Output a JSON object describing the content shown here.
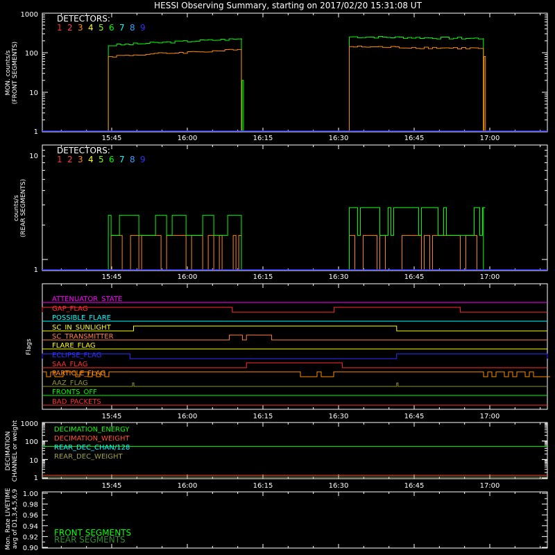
{
  "title": "HESSI Observing Summary, starting on 2017/02/20 15:31:08 UT",
  "time_ticks": [
    "15:45",
    "16:00",
    "16:15",
    "16:30",
    "16:45",
    "17:00"
  ],
  "detectors": {
    "heading": "DETECTORS:",
    "numbers": [
      "1",
      "2",
      "3",
      "4",
      "5",
      "6",
      "7",
      "8",
      "9"
    ],
    "colors": [
      "#ff3030",
      "#ff4040",
      "#ff8c00",
      "#ffff00",
      "#88ff00",
      "#00ff00",
      "#00ffff",
      "#3aa0ff",
      "#3030ff"
    ]
  },
  "panels": {
    "front": {
      "ylabel": [
        "MON. counts/s",
        "(FRONT SEGMENTS)"
      ],
      "yticks": [
        "1000",
        "100",
        "10",
        "1"
      ]
    },
    "rear": {
      "ylabel": [
        "counts/s",
        "(REAR SEGMENTS)"
      ],
      "yticks": [
        "10",
        "1"
      ]
    },
    "flags": {
      "ylabel": "Flags",
      "items": [
        {
          "label": "ATTENUATOR_STATE",
          "color": "#ff00ff"
        },
        {
          "label": "GAP_FLAG",
          "color": "#ff3030"
        },
        {
          "label": "POSSIBLE_FLARE",
          "color": "#00ffff"
        },
        {
          "label": "SC_IN_SUNLIGHT",
          "color": "#ffff00"
        },
        {
          "label": "SC_TRANSMITTER",
          "color": "#ff8040"
        },
        {
          "label": "FLARE_FLAG",
          "color": "#ffff00"
        },
        {
          "label": "ECLIPSE_FLAG",
          "color": "#3030ff"
        },
        {
          "label": "SAA_FLAG",
          "color": "#ff3030"
        },
        {
          "label": "PARTICLE_FLAG",
          "color": "#ff8c00"
        },
        {
          "label": "AAZ_FLAG",
          "color": "#909030"
        },
        {
          "label": "FRONTS_OFF",
          "color": "#00ff00"
        },
        {
          "label": "BAD_PACKETS",
          "color": "#ff3030"
        }
      ]
    },
    "decimation": {
      "ylabel": [
        "DECIMATION",
        "CHANNEL or weight"
      ],
      "yticks": [
        "1000",
        "100",
        "10",
        "1"
      ],
      "legend": [
        {
          "label": "DECIMATION_ENERGY",
          "color": "#00ff00"
        },
        {
          "label": "DECIMATION_WEIGHT",
          "color": "#ff5030"
        },
        {
          "label": "REAR_DEC_CHAN/128",
          "color": "#00ffff"
        },
        {
          "label": "REAR_DEC_WEIGHT",
          "color": "#a0a040"
        }
      ]
    },
    "livetime": {
      "ylabel": [
        "Mon. Rate LIVETIME",
        "avg of D1,3,4,5,6,9"
      ],
      "yticks": [
        "1.00",
        "0.98",
        "0.96",
        "0.94",
        "0.92",
        "0.90"
      ],
      "legend": [
        {
          "label": "FRONT SEGMENTS",
          "color": "#00ff00"
        },
        {
          "label": "REAR SEGMENTS",
          "color": "#2e8b2e"
        }
      ]
    }
  },
  "chart_data": [
    {
      "type": "line",
      "title": "HESSI Observing Summary, starting on 2017/02/20 15:31:08 UT",
      "ylabel": "MON. counts/s (FRONT SEGMENTS)",
      "yscale": "log",
      "ylim": [
        1,
        1000
      ],
      "x_units": "minutes after 15:31:08 UT",
      "segments": [
        {
          "start_min": 13.2,
          "end_min": 39.6
        },
        {
          "start_min": 61.0,
          "end_min": 87.6
        }
      ],
      "series": [
        {
          "name": "6",
          "color": "#00ff00",
          "level_a": 180,
          "level_b": 240
        },
        {
          "name": "3",
          "color": "#ff8c00",
          "level_a": 95,
          "level_b": 135
        }
      ]
    },
    {
      "type": "line",
      "ylabel": "counts/s (REAR SEGMENTS)",
      "yscale": "log",
      "ylim": [
        1,
        10
      ],
      "series": [
        {
          "name": "6",
          "color": "#00ff00",
          "low": 2,
          "high": 3
        },
        {
          "name": "3",
          "color": "#ff8c00",
          "low": 1,
          "high": 2
        }
      ]
    },
    {
      "type": "line",
      "ylabel": "Flags",
      "events": {
        "GAP_FLAG_high": [
          [
            0,
            37.8
          ],
          [
            58.0,
            83.0
          ]
        ],
        "SC_IN_SUNLIGHT_high": [
          [
            18.2,
            70.4
          ]
        ],
        "SC_TRANSMITTER_high": [
          [
            37.2,
            39.8
          ],
          [
            40.6,
            45.6
          ]
        ],
        "ECLIPSE_FLAG_high": [
          [
            0,
            17.5
          ],
          [
            70.4,
            100
          ]
        ],
        "SAA_FLAG_high": [
          [
            40.6,
            59.6
          ]
        ],
        "AAZ_FLAG_spikes": [
          18.0,
          70.4
        ]
      }
    },
    {
      "type": "line",
      "ylabel": "DECIMATION CHANNEL or weight",
      "yscale": "log",
      "ylim": [
        1,
        1000
      ],
      "series": [
        {
          "name": "DECIMATION_ENERGY",
          "value": 50
        },
        {
          "name": "DECIMATION_WEIGHT",
          "value": 1.4
        },
        {
          "name": "REAR_DEC_CHAN/128",
          "value": 0
        },
        {
          "name": "REAR_DEC_WEIGHT",
          "value": 1.1
        }
      ]
    },
    {
      "type": "line",
      "ylabel": "Mon. Rate LIVETIME avg of D1,3,4,5,6,9",
      "ylim": [
        0.9,
        1.0
      ],
      "series": [
        {
          "name": "FRONT SEGMENTS",
          "values": []
        },
        {
          "name": "REAR SEGMENTS",
          "values": []
        }
      ]
    }
  ]
}
